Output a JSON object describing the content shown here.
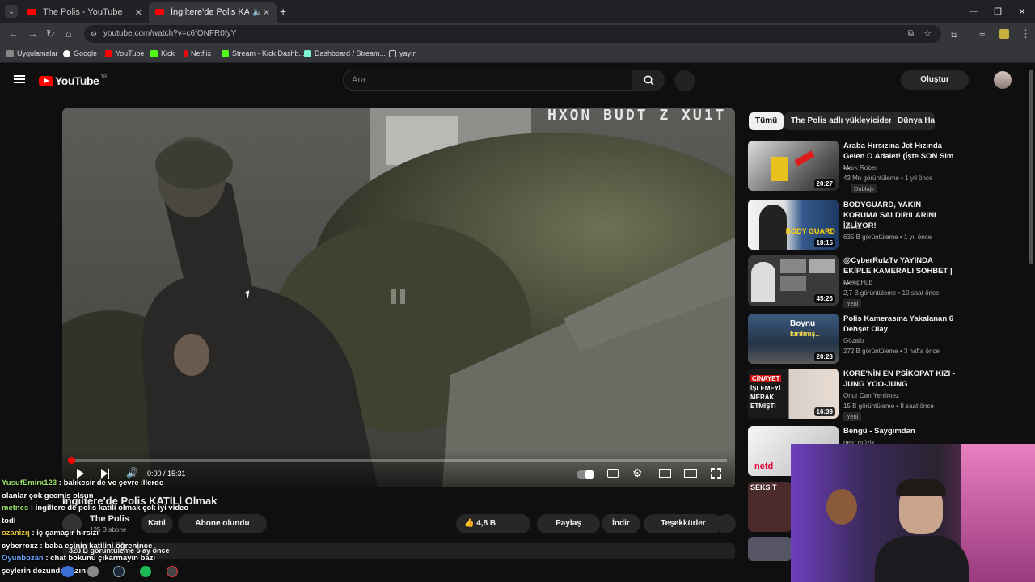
{
  "browser": {
    "tabs": [
      {
        "title": "The Polis - YouTube"
      },
      {
        "title": "İngiltere'de Polis KATİLİ Olm"
      }
    ],
    "url": "youtube.com/watch?v=c6fONFR0fyY",
    "bookmarks": [
      "Uygulamalar",
      "Google",
      "YouTube",
      "Kick",
      "Netflix",
      "Stream - Kick Dashb...",
      "Dashboard / Stream...",
      "yayın"
    ]
  },
  "youtube": {
    "logo_text": "YouTube",
    "logo_region": "TR",
    "search_placeholder": "Ara",
    "signin_label": "Oluştur"
  },
  "player": {
    "time": "0:00 / 15:31",
    "overlay_text": "HXON BUDT Z XU1T",
    "progress": 0.0
  },
  "video": {
    "title": "İngiltere'de Polis KATİLİ Olmak",
    "channel": "The Polis",
    "subs": "135 B abone",
    "join": "Katıl",
    "subscribed": "Abone olundu",
    "likes": "4,8 B",
    "share": "Paylaş",
    "download": "İndir",
    "thanks": "Teşekkürler",
    "views": "328 B görüntüleme  5 ay önce"
  },
  "chips": [
    "Tümü",
    "The Polis adlı yükleyiciden",
    "Dünya Hab"
  ],
  "recs": [
    {
      "title": "Araba Hırsızına Jet Hızında Gelen O Adalet! (İşte SON Sim ...",
      "channel": "Mark Rober",
      "meta": "43 Mn görüntüleme • 1 yıl önce",
      "badge": "Dublajlı",
      "duration": "20:27"
    },
    {
      "title": "BODYGUARD, YAKIN KORUMA SALDIRILARINI İZLİYOR!",
      "channel": "Literat",
      "meta": "635 B görüntüleme • 1 yıl önce",
      "badge": "",
      "duration": "18:15"
    },
    {
      "title": "@CyberRulzTv  YAYINDA EKİPLE KAMERALI SOHBET | ...",
      "channel": "MekipHub",
      "meta": "2,7 B görüntüleme • 10 saat önce",
      "badge": "Yeni",
      "duration": "45:26"
    },
    {
      "title": "Polis Kamerasına Yakalanan 6 Dehşet Olay",
      "channel": "Gözaltı",
      "meta": "272 B görüntüleme • 3 hafta önce",
      "badge": "",
      "duration": "20:23"
    },
    {
      "title": "KORE'NİN EN PSİKOPAT KIZI - JUNG YOO-JUNG",
      "channel": "Onur Can Yenilmez",
      "meta": "15 B görüntüleme • 8 saat önce",
      "badge": "Yeni",
      "duration": "16:39"
    },
    {
      "title": "Bengü - Saygımdan",
      "channel": "netd müzik",
      "meta": "",
      "badge": "",
      "duration": ""
    }
  ],
  "thumb_text": {
    "r2": "BODY GUARD",
    "r4a": "Boynu",
    "r4b": "kırılmış..",
    "r5a": "CİNAYET",
    "r5b": "İŞLEMEYİ",
    "r5c": "MERAK",
    "r5d": "ETMİŞTİ",
    "r6": "netd",
    "r7": "SEKS T"
  },
  "chat": [
    {
      "user": "YusufEmirx123",
      "msg": " : balıkesir de ve çevre illerde",
      "color": "#9be36b"
    },
    {
      "user": "",
      "msg": "olanlar çok gecmis olsun",
      "color": "#ffffff"
    },
    {
      "user": "metnes",
      "msg": " : ingiltere de polis katili olmak çok iyi video",
      "color": "#9be36b"
    },
    {
      "user": "",
      "msg": "todi",
      "color": "#ffffff"
    },
    {
      "user": "ozanizq",
      "msg": " : iç çamaşır hırsızı",
      "color": "#e8c23b"
    },
    {
      "user": "cyberroxz",
      "msg": " : baba eşinin katilini öğrenince",
      "color": "#ffffff"
    },
    {
      "user": "Oyunbozan",
      "msg": " : chat bokunu çıkarmayın bazı",
      "color": "#6aa7ff"
    },
    {
      "user": "",
      "msg": "şeylerin dozunda yazın",
      "color": "#ffffff"
    }
  ]
}
